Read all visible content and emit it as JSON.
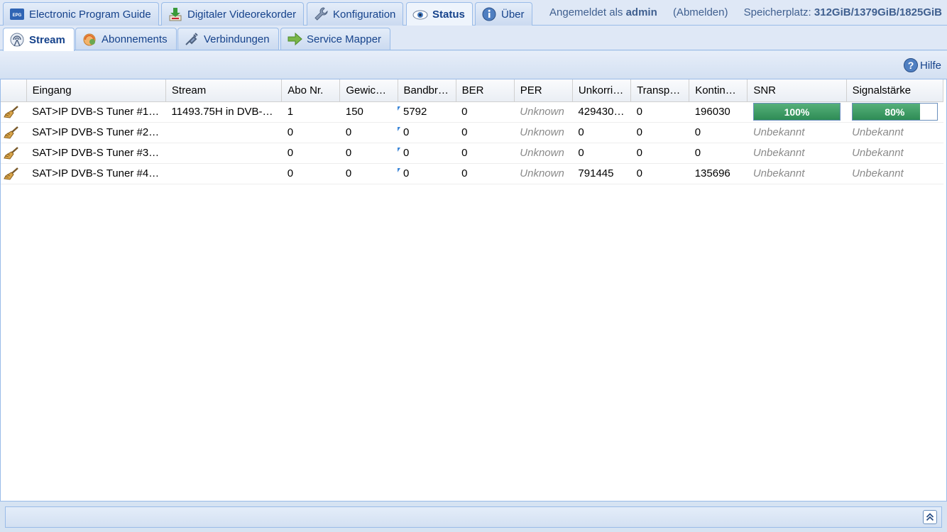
{
  "top_tabs": [
    {
      "label": "Electronic Program Guide",
      "icon": "epg-icon"
    },
    {
      "label": "Digitaler Videorekorder",
      "icon": "download-icon"
    },
    {
      "label": "Konfiguration",
      "icon": "wrench-icon"
    },
    {
      "label": "Status",
      "icon": "eye-icon"
    },
    {
      "label": "Über",
      "icon": "info-icon"
    }
  ],
  "user": {
    "prefix": "Angemeldet als",
    "name": "admin",
    "logout": "(Abmelden)",
    "storage_label": "Speicherplatz:",
    "storage_value": "312GiB/1379GiB/1825GiB"
  },
  "sub_tabs": [
    {
      "label": "Stream",
      "icon": "antenna-icon"
    },
    {
      "label": "Abonnements",
      "icon": "subscriptions-icon"
    },
    {
      "label": "Verbindungen",
      "icon": "plug-icon"
    },
    {
      "label": "Service Mapper",
      "icon": "arrow-right-icon"
    }
  ],
  "toolbar": {
    "help_label": "Hilfe"
  },
  "grid": {
    "columns": [
      "",
      "Eingang",
      "Stream",
      "Abo Nr.",
      "Gewich…",
      "Bandbr…",
      "BER",
      "PER",
      "Unkorri…",
      "Transp…",
      "Kontinu…",
      "SNR",
      "Signalstärke"
    ],
    "rows": [
      {
        "eingang": "SAT>IP DVB-S Tuner #1…",
        "stream": "11493.75H in DVB-…",
        "abo": "1",
        "gewicht": "150",
        "bandbreite": "5792",
        "ber": "0",
        "per": "Unknown",
        "unkorr": "429430…",
        "transp": "0",
        "kontinu": "196030",
        "snr": "100%",
        "snr_value": 1.0,
        "signal": "80%",
        "signal_value": 0.8
      },
      {
        "eingang": "SAT>IP DVB-S Tuner #2…",
        "stream": "",
        "abo": "0",
        "gewicht": "0",
        "bandbreite": "0",
        "ber": "0",
        "per": "Unknown",
        "unkorr": "0",
        "transp": "0",
        "kontinu": "0",
        "snr": "Unbekannt",
        "signal": "Unbekannt"
      },
      {
        "eingang": "SAT>IP DVB-S Tuner #3…",
        "stream": "",
        "abo": "0",
        "gewicht": "0",
        "bandbreite": "0",
        "ber": "0",
        "per": "Unknown",
        "unkorr": "0",
        "transp": "0",
        "kontinu": "0",
        "snr": "Unbekannt",
        "signal": "Unbekannt"
      },
      {
        "eingang": "SAT>IP DVB-S Tuner #4…",
        "stream": "",
        "abo": "0",
        "gewicht": "0",
        "bandbreite": "0",
        "ber": "0",
        "per": "Unknown",
        "unkorr": "791445",
        "transp": "0",
        "kontinu": "135696",
        "snr": "Unbekannt",
        "signal": "Unbekannt"
      }
    ]
  },
  "colors": {
    "accent": "#15428b",
    "bar_fill": "#2e8c55",
    "border": "#99bbe8"
  }
}
